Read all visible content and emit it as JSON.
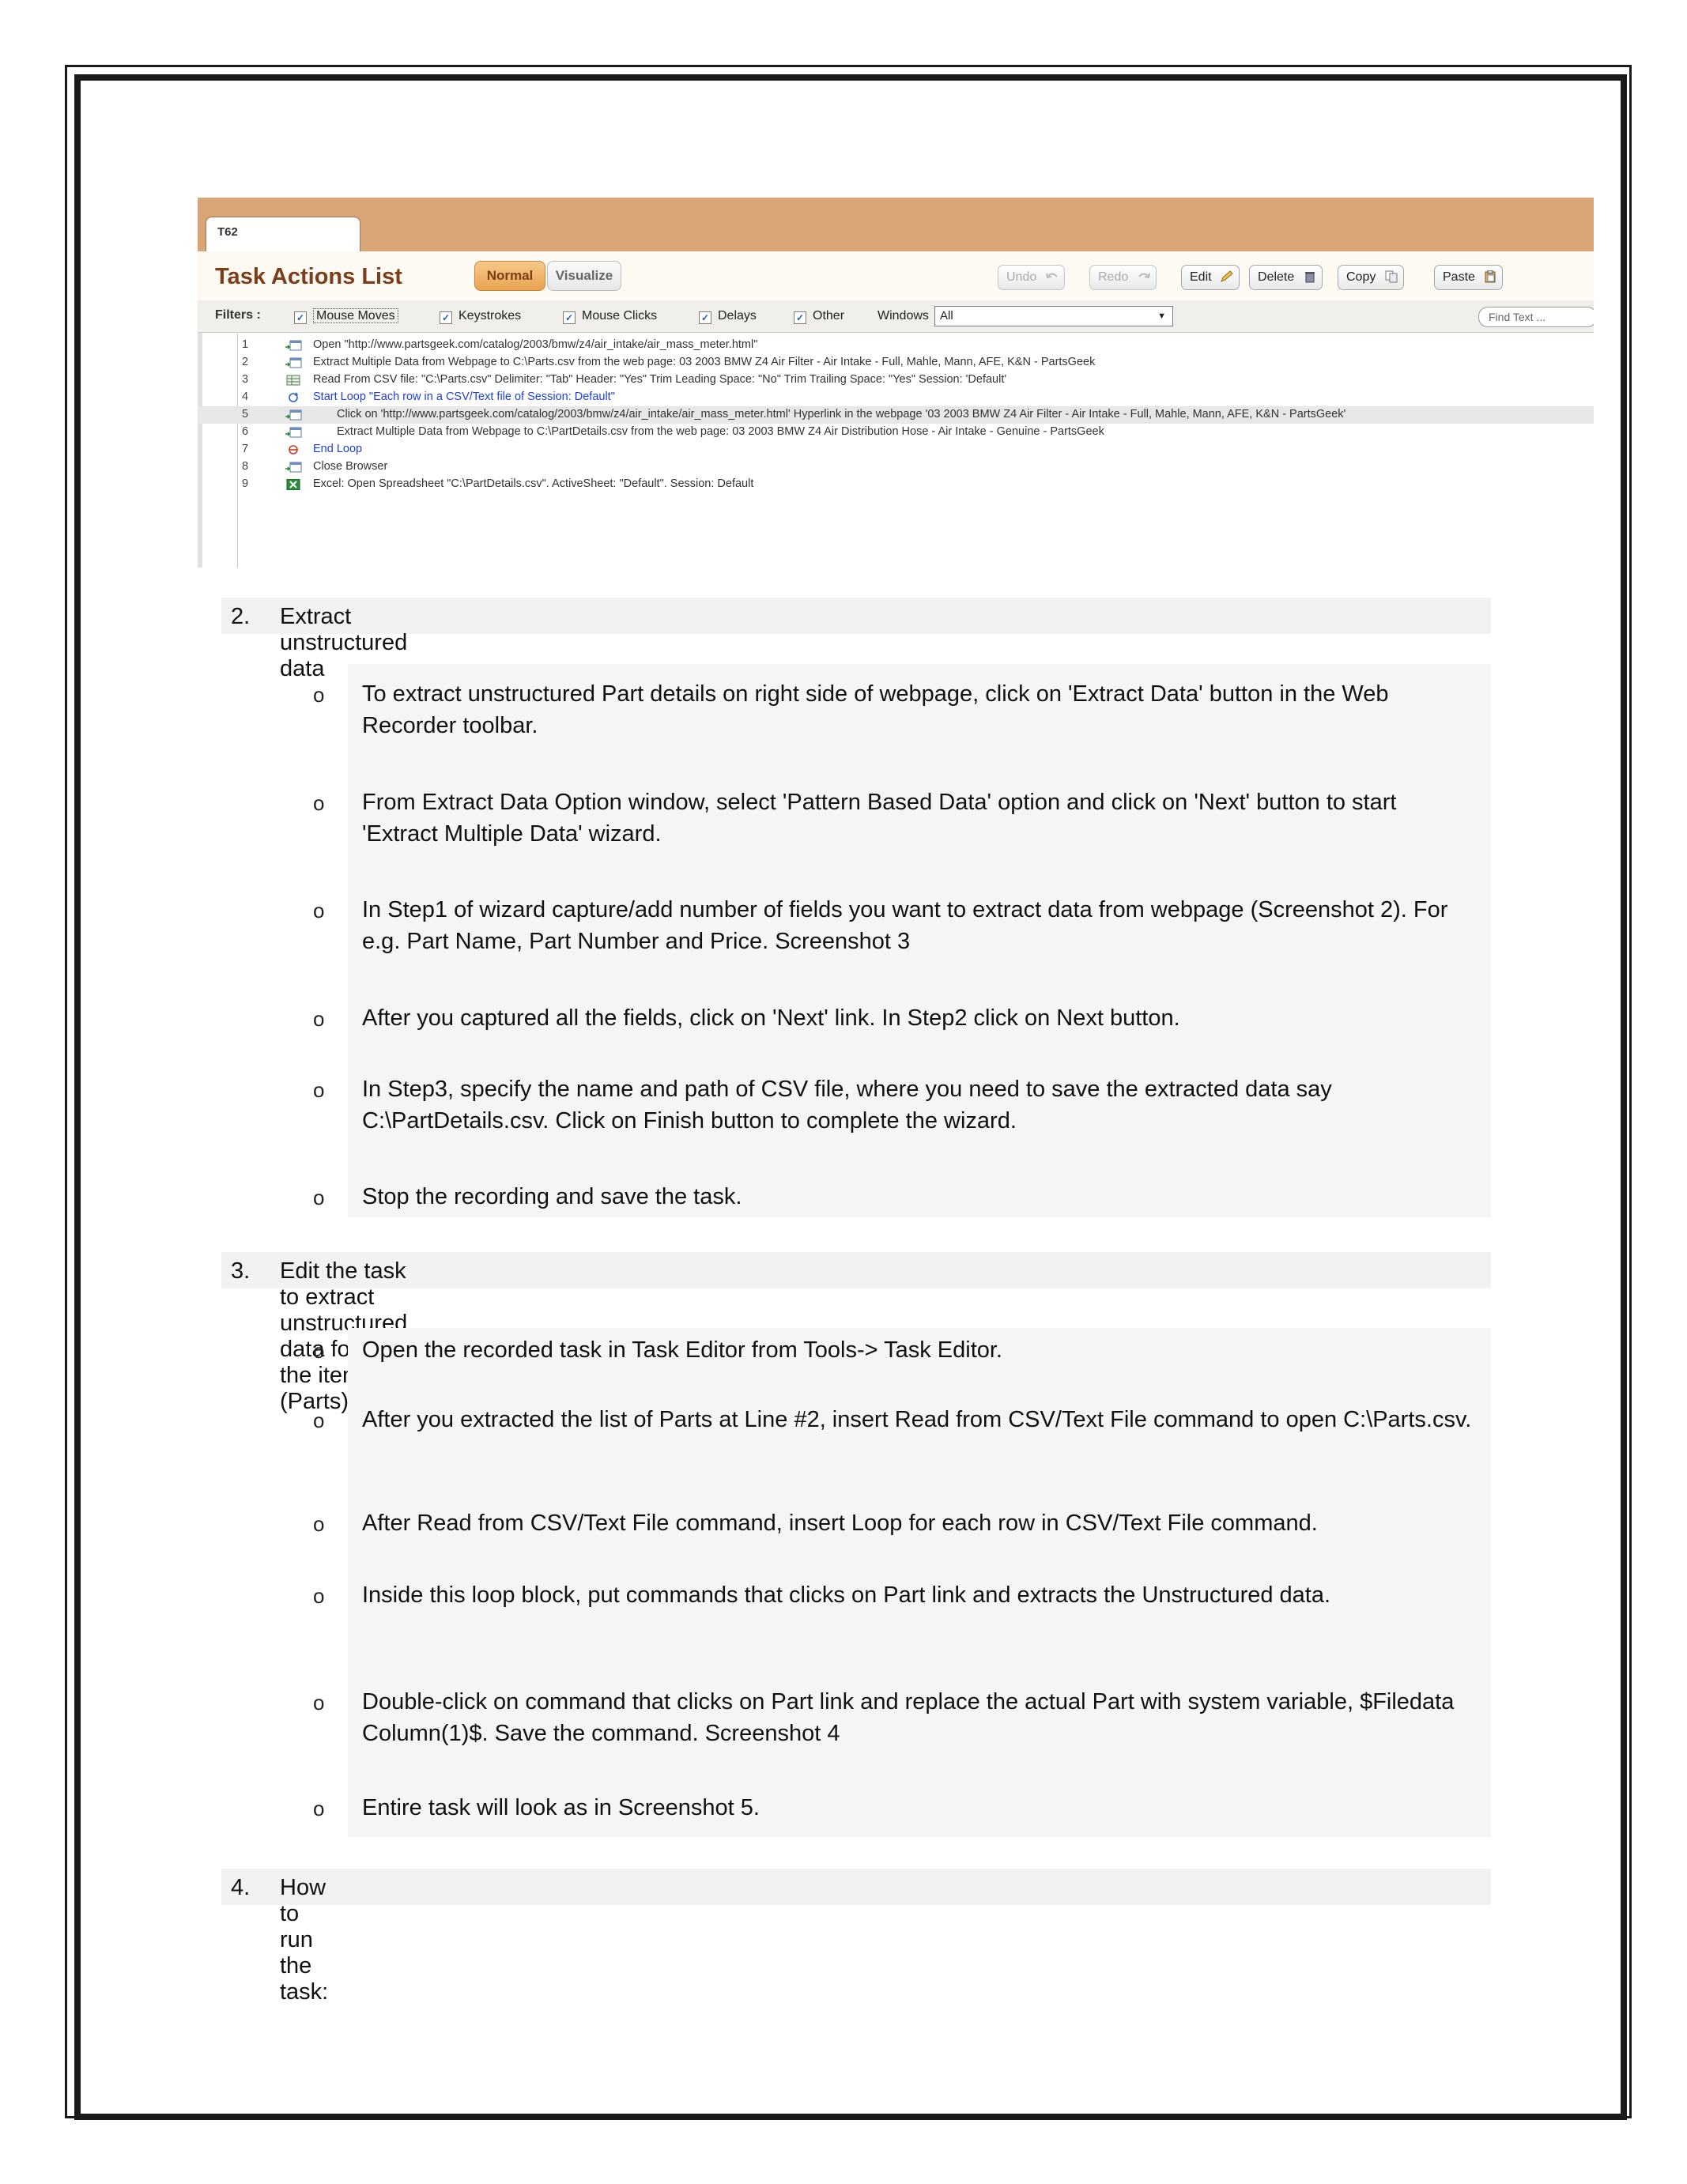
{
  "screenshot": {
    "tab_label": "T62",
    "title": "Task Actions List",
    "mode_normal": "Normal",
    "mode_visualize": "Visualize",
    "buttons": {
      "undo": "Undo",
      "redo": "Redo",
      "edit": "Edit",
      "delete": "Delete",
      "copy": "Copy",
      "paste": "Paste"
    },
    "filters_label": "Filters :",
    "filters": {
      "mouse_moves": "Mouse Moves",
      "keystrokes": "Keystrokes",
      "mouse_clicks": "Mouse Clicks",
      "delays": "Delays",
      "other": "Other"
    },
    "windows_label": "Windows",
    "windows_value": "All",
    "find_placeholder": "Find Text ...",
    "rows": [
      {
        "num": "1",
        "icon": "browser-icon",
        "text": "Open \"http://www.partsgeek.com/catalog/2003/bmw/z4/air_intake/air_mass_meter.html\""
      },
      {
        "num": "2",
        "icon": "browser-icon",
        "text": "Extract Multiple Data from Webpage to C:\\Parts.csv from the web page: 03 2003 BMW Z4 Air Filter - Air Intake - Full, Mahle, Mann, AFE, K&N - PartsGeek"
      },
      {
        "num": "3",
        "icon": "csv-icon",
        "text": "Read From CSV file: \"C:\\Parts.csv\" Delimiter: \"Tab\" Header: \"Yes\" Trim Leading Space: \"No\" Trim Trailing Space: \"Yes\" Session: 'Default'"
      },
      {
        "num": "4",
        "icon": "loop-icon",
        "text": "Start Loop \"Each row in a CSV/Text file of Session: Default\""
      },
      {
        "num": "5",
        "icon": "browser-icon",
        "text": "Click on 'http://www.partsgeek.com/catalog/2003/bmw/z4/air_intake/air_mass_meter.html' Hyperlink in the webpage '03 2003 BMW Z4 Air Filter - Air Intake - Full, Mahle, Mann, AFE, K&N - PartsGeek'"
      },
      {
        "num": "6",
        "icon": "browser-icon",
        "text": "Extract Multiple Data from Webpage to C:\\PartDetails.csv from the web page: 03 2003 BMW Z4 Air Distribution Hose - Air Intake - Genuine - PartsGeek"
      },
      {
        "num": "7",
        "icon": "end-loop-icon",
        "text": "End Loop"
      },
      {
        "num": "8",
        "icon": "browser-icon",
        "text": "Close Browser"
      },
      {
        "num": "9",
        "icon": "excel-icon",
        "text": "Excel: Open Spreadsheet \"C:\\PartDetails.csv\". ActiveSheet: \"Default\". Session: Default"
      }
    ]
  },
  "sections": [
    {
      "num": "2.",
      "heading": "Extract unstructured data",
      "bullets": [
        "To extract unstructured Part details on right side of webpage, click on 'Extract Data' button in the Web Recorder toolbar.",
        "From Extract Data Option window, select 'Pattern Based Data' option and click on 'Next' button to start 'Extract Multiple Data' wizard.",
        "In Step1 of wizard capture/add number of fields you want to extract data from webpage (Screenshot 2). For e.g. Part Name, Part Number and Price. Screenshot 3",
        "After you captured all the fields, click on 'Next' link. In Step2 click on Next button.",
        "In Step3, specify the name and path of CSV file, where you need to save the extracted data say C:\\PartDetails.csv. Click on Finish button to complete the wizard.",
        "Stop the recording and save the task."
      ]
    },
    {
      "num": "3.",
      "heading": "Edit the task to extract unstructured data for all the items (Parts) in list",
      "bullets": [
        "Open the recorded task in Task Editor from Tools-> Task Editor.",
        "After you extracted the list of Parts at Line #2, insert Read from CSV/Text File command to open C:\\Parts.csv.",
        "After Read from CSV/Text File command, insert Loop for each row in CSV/Text File command.",
        "Inside this loop block, put commands that clicks on Part link and extracts the Unstructured data.",
        "Double-click on command that clicks on Part link and replace the actual Part with system variable, $Filedata Column(1)$. Save the command. Screenshot 4",
        "Entire task will look as in Screenshot 5."
      ]
    },
    {
      "num": "4.",
      "heading": "How to run the task:",
      "bullets": []
    }
  ],
  "bullet_glyph": "o"
}
